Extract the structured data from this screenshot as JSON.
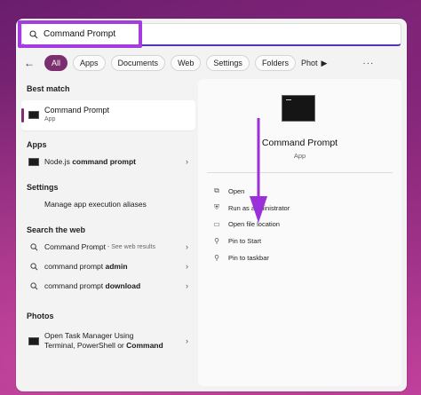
{
  "search": {
    "value": "Command Prompt"
  },
  "filters": {
    "chips": [
      "All",
      "Apps",
      "Documents",
      "Web",
      "Settings",
      "Folders",
      "Phot"
    ],
    "active_index": 0
  },
  "left": {
    "best_match_header": "Best match",
    "best_match": {
      "title": "Command Prompt",
      "subtitle": "App"
    },
    "apps_header": "Apps",
    "apps_item": {
      "prefix": "Node.js ",
      "bold": "command prompt"
    },
    "settings_header": "Settings",
    "settings_item": "Manage app execution aliases",
    "web_header": "Search the web",
    "web_items": [
      {
        "label": "Command Prompt",
        "note": " - See web results"
      },
      {
        "prefix": "command prompt ",
        "bold": "admin"
      },
      {
        "prefix": "command prompt ",
        "bold": "download"
      }
    ],
    "photos_header": "Photos",
    "photos_item": {
      "line1": "Open Task Manager Using",
      "line2_prefix": "Terminal, PowerShell or ",
      "line2_bold": "Command"
    }
  },
  "right": {
    "title": "Command Prompt",
    "subtitle": "App",
    "actions": [
      {
        "label": "Open",
        "icon": "open-icon"
      },
      {
        "label": "Run as administrator",
        "icon": "shield-icon"
      },
      {
        "label": "Open file location",
        "icon": "folder-icon"
      },
      {
        "label": "Pin to Start",
        "icon": "pin-icon"
      },
      {
        "label": "Pin to taskbar",
        "icon": "pin-icon"
      }
    ]
  },
  "colors": {
    "accent": "#7b2f6e",
    "highlight": "#a53ce0",
    "arrow": "#9b2fd9"
  }
}
